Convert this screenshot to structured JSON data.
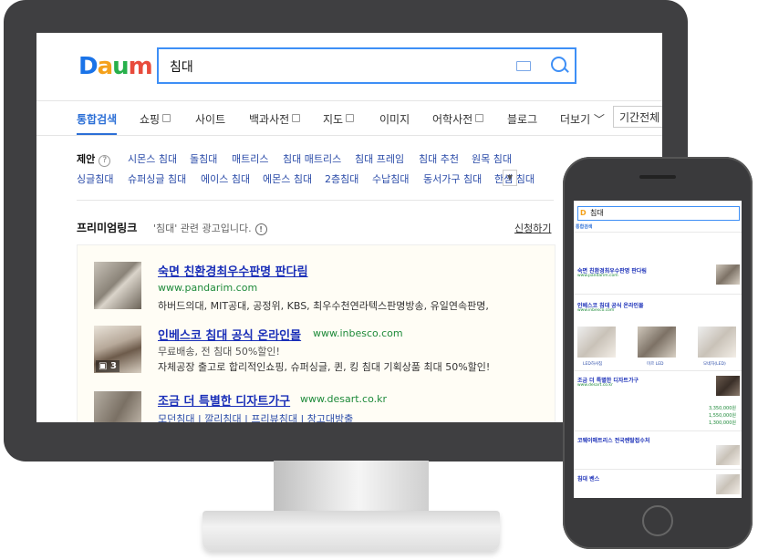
{
  "logo": {
    "text": "Daum",
    "colors": [
      "#1a73e8",
      "#f4a11b",
      "#27b04b",
      "#e84b3c"
    ]
  },
  "search": {
    "query": "침대"
  },
  "tabs": [
    {
      "label": "통합검색",
      "active": true
    },
    {
      "label": "쇼핑",
      "check": true
    },
    {
      "label": "사이트"
    },
    {
      "label": "백과사전",
      "check": true
    },
    {
      "label": "지도",
      "check": true
    },
    {
      "label": "이미지"
    },
    {
      "label": "어학사전",
      "check": true
    },
    {
      "label": "블로그"
    },
    {
      "label": "더보기 ﹀"
    }
  ],
  "period": "기간전체",
  "suggestions": {
    "label": "제안",
    "row1": [
      "시몬스 침대",
      "돌침대",
      "매트리스",
      "침대 매트리스",
      "침대 프레임",
      "침대 추천",
      "원목 침대"
    ],
    "row2": [
      "싱글침대",
      "슈퍼싱글 침대",
      "에이스 침대",
      "에몬스 침대",
      "2층침대",
      "수납침대",
      "동서가구 침대",
      "한샘 침대"
    ]
  },
  "premium": {
    "title": "프리미엄링크",
    "subtitle": "'침대' 관련 광고입니다.",
    "apply": "신청하기",
    "ads": [
      {
        "title": "숙면 친환경최우수판명 판다림",
        "url": "www.pandarim.com",
        "desc": "하버드의대, MIT공대, 공정위, KBS, 최우수천연라텍스판명방송, 유일연속판명,"
      },
      {
        "title": "인베스코 침대 공식 온라인몰",
        "url": "www.inbesco.com",
        "desc1": "무료배송, 전 침대 50%할인!",
        "desc2": "자체공장 출고로 합리적인쇼핑, 슈퍼싱글, 퀸, 킹 침대 기획상품 최대 50%할인!",
        "photo_count": "3"
      },
      {
        "title": "조금 더 특별한 디자트가구",
        "url": "www.desart.co.kr",
        "links": [
          "모던침대",
          "깔리침대",
          "프리뷰침대",
          "창고대방출"
        ]
      }
    ]
  },
  "phone": {
    "query": "침대",
    "ad_titles": [
      "숙면 친환경최우수판명 판다림",
      "인베스코 침대 공식 온라인몰",
      "조금 더 특별한 디자트가구",
      "코웨이매트리스 전국렌탈접수처",
      "침대 벤스"
    ],
    "captions": [
      "LED하샤침",
      "미르 LED",
      "모네자(LED)"
    ],
    "prices": [
      "3,350,000원",
      "1,550,000원",
      "1,300,000원"
    ]
  }
}
